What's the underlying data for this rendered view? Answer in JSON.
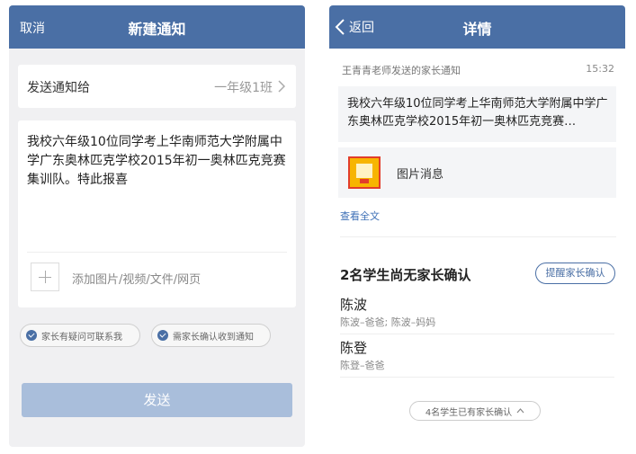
{
  "new_notice": {
    "nav": {
      "cancel_label": "取消",
      "title": "新建通知"
    },
    "recipient": {
      "label": "发送通知给",
      "value": "一年级1班"
    },
    "message": {
      "text": "我校六年级10位同学考上华南师范大学附属中学广东奥林匹克学校2015年初一奥林匹克竞赛集训队。特此报喜"
    },
    "attach": {
      "placeholder": "添加图片/视频/文件/网页"
    },
    "options": [
      {
        "label": "家长有疑问可联系我",
        "checked": true
      },
      {
        "label": "需家长确认收到通知",
        "checked": true
      }
    ],
    "send_label": "发送"
  },
  "detail": {
    "nav": {
      "back_label": "返回",
      "title": "详情"
    },
    "sender_line": "王青青老师发送的家长通知",
    "time": "15:32",
    "preview_text": "我校六年级10位同学考上华南师范大学附属中学广东奥林匹克学校2015年初一奥林匹克竞赛…",
    "image_message_label": "图片消息",
    "view_full_label": "查看全文",
    "pending_title": "2名学生尚无家长确认",
    "remind_label": "提醒家长确认",
    "students": [
      {
        "name": "陈波",
        "parents": "陈波–爸爸; 陈波–妈妈"
      },
      {
        "name": "陈登",
        "parents": "陈登–爸爸"
      }
    ],
    "confirmed_label": "4名学生已有家长确认"
  },
  "colors": {
    "nav_blue": "#4a6fa5",
    "link_blue": "#3d6fb6",
    "send_disabled": "#a9bedb",
    "screen_bg": "#f0f0f2"
  },
  "icons": [
    "chevron-left-icon",
    "chevron-right-icon",
    "plus-icon",
    "check-circle-icon",
    "chevron-up-icon",
    "image-thumbnail"
  ]
}
